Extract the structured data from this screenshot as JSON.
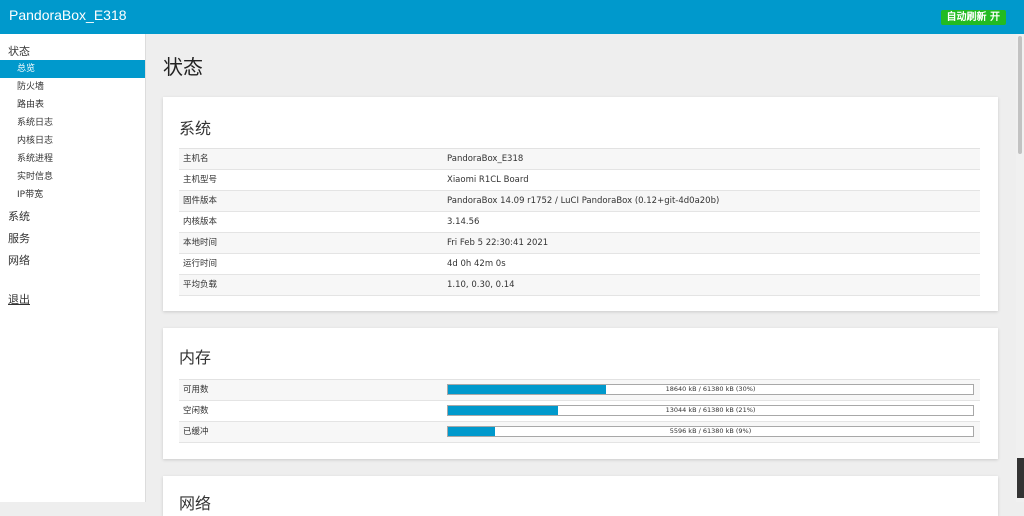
{
  "header": {
    "brand": "PandoraBox_E318",
    "refresh_label": "自动刷新 开"
  },
  "sidebar": {
    "sections": [
      {
        "label": "状态"
      },
      {
        "label": "系统"
      },
      {
        "label": "服务"
      },
      {
        "label": "网络"
      }
    ],
    "status_items": [
      "总览",
      "防火墙",
      "路由表",
      "系统日志",
      "内核日志",
      "系统进程",
      "实时信息",
      "IP带宽"
    ],
    "logout": "退出"
  },
  "page": {
    "title": "状态"
  },
  "system": {
    "title": "系统",
    "rows": [
      {
        "key": "主机名",
        "value": "PandoraBox_E318"
      },
      {
        "key": "主机型号",
        "value": "Xiaomi R1CL Board"
      },
      {
        "key": "固件版本",
        "value": "PandoraBox 14.09 r1752 / LuCI PandoraBox (0.12+git-4d0a20b)"
      },
      {
        "key": "内核版本",
        "value": "3.14.56"
      },
      {
        "key": "本地时间",
        "value": "Fri Feb 5 22:30:41 2021"
      },
      {
        "key": "运行时间",
        "value": "4d 0h 42m 0s"
      },
      {
        "key": "平均负载",
        "value": "1.10, 0.30, 0.14"
      }
    ]
  },
  "memory": {
    "title": "内存",
    "rows": [
      {
        "key": "可用数",
        "text": "18640 kB / 61380 kB (30%)",
        "percent": 30
      },
      {
        "key": "空闲数",
        "text": "13044 kB / 61380 kB (21%)",
        "percent": 21
      },
      {
        "key": "已缓冲",
        "text": "5596 kB / 61380 kB (9%)",
        "percent": 9
      }
    ]
  },
  "network": {
    "title": "网络"
  },
  "colors": {
    "accent": "#0099cc",
    "refresh_bg": "#22bb22"
  }
}
